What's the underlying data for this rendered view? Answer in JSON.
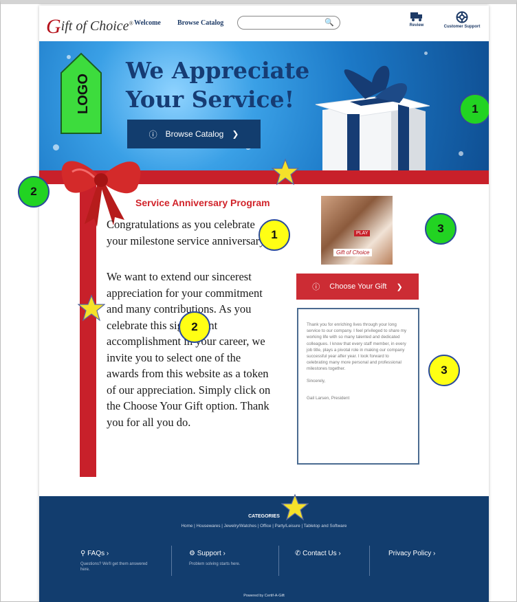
{
  "header": {
    "brand": {
      "initial": "G",
      "rest": "ift of Choice",
      "reg": "®"
    },
    "nav": [
      "Welcome",
      "Browse Catalog"
    ],
    "search_placeholder": "",
    "icons": [
      {
        "name": "truck-icon",
        "label": "Review"
      },
      {
        "name": "lifebuoy-icon",
        "label": "Customer Support"
      }
    ]
  },
  "hero": {
    "headline_line1": "We Appreciate",
    "headline_line2": "Your Service!",
    "logo_label": "LOGO",
    "browse_button": "Browse Catalog"
  },
  "content": {
    "program_title": "Service Anniversary Program",
    "paragraph1": "Congratulations as you celebrate your milestone service anniversary!",
    "paragraph2": "We want to extend our sincerest appreciation for your commitment and many contributions. As you celebrate this significant accomplishment in your career, we invite you to select one of the awards from this website as a token of our appreciation.  Simply click on the Choose Your Gift option. Thank you for all you do.",
    "photo_label": "Gift of Choice",
    "photo_play": "PLAY",
    "choose_button": "Choose Your Gift",
    "letter_body": "Thank you for enriching lives through your long service to our company.  I feel privileged to share my working life with so many talented and dedicated colleagues.  I know that every staff member, in every job title, plays a pivotal role in making our company successful year after year.  I look forward to celebrating many more personal and professional milestones together.",
    "letter_closing": "Sincerely,",
    "letter_signature": "Gail Larsen, President"
  },
  "footer": {
    "categories_title": "CATEGORIES",
    "categories_links": "Home | Housewares | Jewelry/Watches | Office | Party/Leisure | Tabletop and Software",
    "columns": [
      {
        "title": "FAQs ›",
        "sub": "Questions? We'll get them answered here."
      },
      {
        "title": "Support ›",
        "sub": "Problem solving starts here."
      },
      {
        "title": "Contact Us ›",
        "sub": ""
      },
      {
        "title": "Privacy Policy ›",
        "sub": ""
      }
    ],
    "powered": "Powered by Certif-A-Gift"
  },
  "annotations": {
    "badge_hero": "1",
    "badge_bow": "2",
    "badge_text1": "1",
    "badge_photo": "3",
    "badge_text2": "2",
    "badge_letter": "3"
  },
  "colors": {
    "navy": "#123d6e",
    "ribbon_red": "#c8202a",
    "accent_red": "#d1232a",
    "badge_green": "#22d322",
    "badge_yellow": "#ffff14"
  }
}
